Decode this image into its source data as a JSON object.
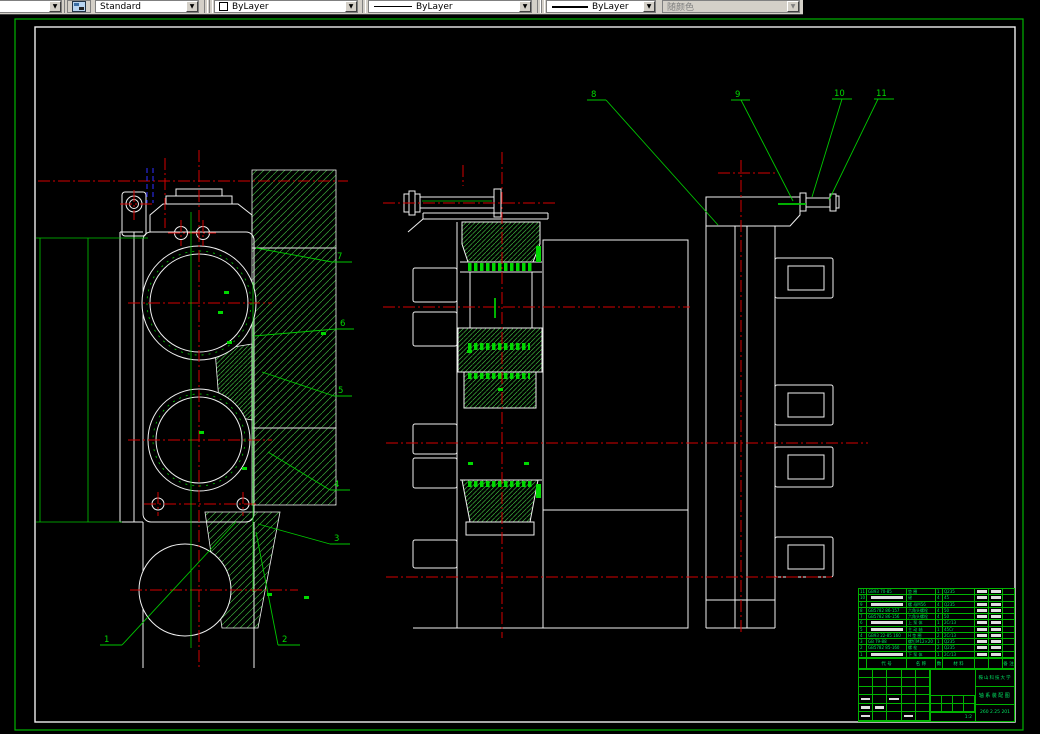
{
  "toolbar": {
    "style_combo": {
      "value": "Standard"
    },
    "color_combo": {
      "value": "ByLayer"
    },
    "linetype_combo": {
      "value": "ByLayer"
    },
    "lineweight_combo": {
      "value": "ByLayer"
    },
    "plotstyle_combo": {
      "value": "随颜色"
    }
  },
  "icons": {
    "dropdown_arrow": "▼"
  },
  "callouts": {
    "labels": [
      "1",
      "2",
      "3",
      "4",
      "5",
      "6",
      "7",
      "8",
      "9",
      "10",
      "11"
    ]
  },
  "title_block": {
    "university": "鞍山科技大学",
    "drawing_title": "轴系装配图",
    "drawing_number": "260 2.25 201",
    "scale": "1:2",
    "parts_header": {
      "code": "代 号",
      "name": "名 称",
      "qty": "数",
      "material": "材 料",
      "note": "备 注"
    },
    "parts": [
      {
        "no": "11",
        "code": "GB93 70-85",
        "name": "垫 圈",
        "qty": "1",
        "mat": "Q235"
      },
      {
        "no": "10",
        "code": "",
        "name": "键",
        "qty": "4",
        "mat": "45"
      },
      {
        "no": "9",
        "code": "",
        "name": "螺 母M56",
        "qty": "4",
        "mat": "Q235"
      },
      {
        "no": "8",
        "code": "GB5782 86-157",
        "name": "六角头螺栓",
        "qty": "4",
        "mat": "50"
      },
      {
        "no": "7",
        "code": "GB5782 86-156",
        "name": "六角头螺栓",
        "qty": "4",
        "mat": "50"
      },
      {
        "no": "6",
        "code": "",
        "name": "上 泵 体",
        "qty": "1",
        "mat": "2Cr13"
      },
      {
        "no": "5",
        "code": "",
        "name": "主 动 轴",
        "qty": "1",
        "mat": "45Cr"
      },
      {
        "no": "4",
        "code": "GB93 22-85 160",
        "name": "H 垫 圈",
        "qty": "2",
        "mat": "2Cr13"
      },
      {
        "no": "3",
        "code": "GB T9-88",
        "name": "螺钉M12×20",
        "qty": "1",
        "mat": "Q235"
      },
      {
        "no": "2",
        "code": "GB5782 85-160",
        "name": "螺 栓",
        "qty": "2",
        "mat": "Q235"
      },
      {
        "no": "1",
        "code": "",
        "name": "下 泵 体",
        "qty": "1",
        "mat": "2Cr13"
      }
    ]
  },
  "colors": {
    "outline_white": "#f0f0f0",
    "centerline_red": "#d40000",
    "detail_green": "#00c800",
    "hatch_green": "#3aa83a",
    "frame_green": "#00b400",
    "hidden_blue": "#2828dc"
  }
}
